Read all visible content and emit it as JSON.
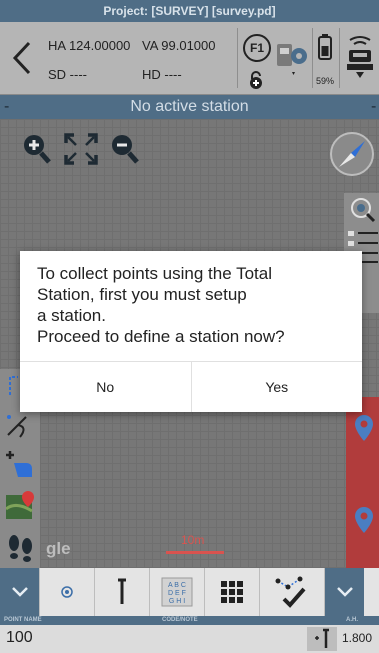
{
  "title_bar": {
    "text": "Project: [SURVEY] [survey.pd]"
  },
  "header": {
    "ha": "HA 124.00000",
    "va": "VA 99.01000",
    "sd": "SD ----",
    "hd": "HD ----",
    "f1_label": "F1",
    "battery_percent": "59%"
  },
  "station_bar": {
    "text": "No active station",
    "left_dash": "-",
    "right_dash": "-"
  },
  "map": {
    "attribution": "gle",
    "scale_label": "10m"
  },
  "dialog": {
    "message_line1": "To collect points using the Total",
    "message_line2": "Station, first you must setup",
    "message_line3": "a station.",
    "message_line4": "Proceed to define a station now?",
    "no_label": "No",
    "yes_label": "Yes"
  },
  "bottom_toolbar": {
    "code_icon_text": "ABC DEF GHI"
  },
  "labels_bar": {
    "point_name": "POINT NAME",
    "code_note": "CODE/NOTE",
    "ah": "A.H."
  },
  "value_bar": {
    "point_value": "100",
    "ah_value": "1.800"
  },
  "colors": {
    "accent": "#4f6d86",
    "header_bg": "#b5b5b5",
    "scale_red": "#d9534f",
    "side_red": "#b13c3c"
  }
}
